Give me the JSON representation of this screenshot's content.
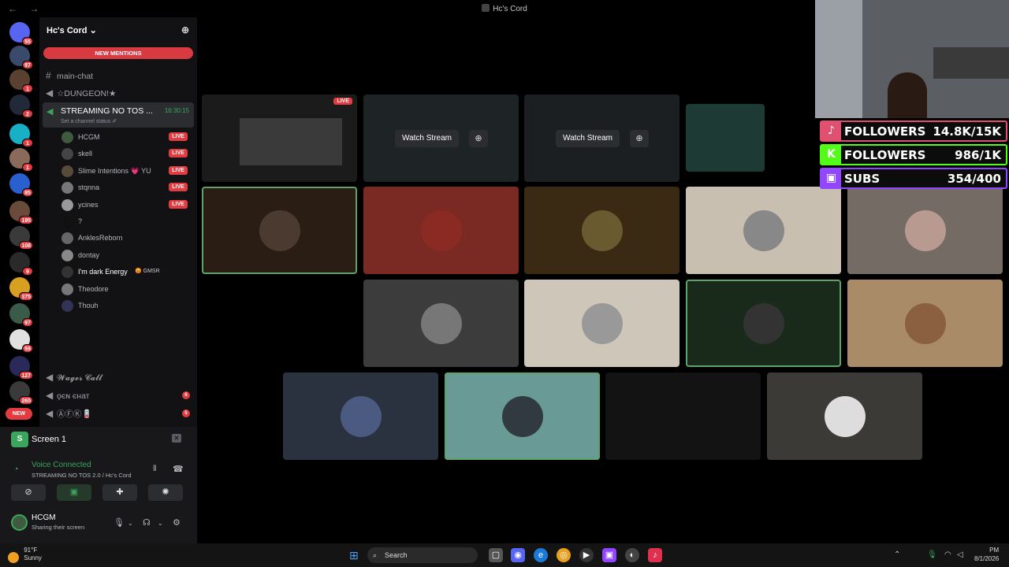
{
  "window": {
    "title": "Hc's Cord",
    "nav_back": "←",
    "nav_fwd": "→"
  },
  "servers": [
    {
      "badge": "55",
      "color": "#5865f2"
    },
    {
      "badge": "97",
      "color": "#3a4a6a"
    },
    {
      "badge": "1",
      "color": "#5a4030"
    },
    {
      "badge": "2",
      "color": "#222a3a"
    },
    {
      "badge": "1",
      "color": "#17b0c6"
    },
    {
      "badge": "1",
      "color": "#8a6a5a"
    },
    {
      "badge": "85",
      "color": "#2a5fd0"
    },
    {
      "badge": "195",
      "color": "#6a4a3a"
    },
    {
      "badge": "108",
      "color": "#3a3a3a"
    },
    {
      "badge": "9",
      "color": "#2a2a2a"
    },
    {
      "badge": "375",
      "color": "#d8a020"
    },
    {
      "badge": "97",
      "color": "#3a5a4a"
    },
    {
      "badge": "59",
      "color": "#e0e0e0"
    },
    {
      "badge": "127",
      "color": "#2a2a5a"
    },
    {
      "badge": "265",
      "color": "#3a3a3a"
    }
  ],
  "new_pill": "NEW",
  "server_name": "Hc's Cord",
  "server_caret": "⌄",
  "new_mentions": "NEW MENTIONS",
  "channels": {
    "main_chat": "main-chat",
    "dungeon": "☆DUNGEON!★",
    "wager": "𝓦𝓪𝓰𝓮𝓻 𝓒𝓪𝓵𝓵",
    "gen": "ǫєɴ єнат",
    "afk": "ⒶⒻⓀ🪫"
  },
  "channel_badges": {
    "gen": "6",
    "afk": "5"
  },
  "voice_channel": {
    "name": "STREAMING NO TOS ...",
    "status": "Set a channel status ✐",
    "timer": "16:30:15"
  },
  "voice_users": [
    {
      "name": "HCGM",
      "live": "LIVE",
      "color": "#3e5b3f"
    },
    {
      "name": "skell",
      "live": "LIVE",
      "color": "#444"
    },
    {
      "name": "Slime Intentions 💗 YU",
      "live": "LIVE",
      "color": "#5a4a3a"
    },
    {
      "name": "stqnna",
      "live": "LIVE",
      "color": "#777"
    },
    {
      "name": "ycines",
      "live": "LIVE",
      "color": "#999"
    },
    {
      "name": "?",
      "live": "",
      "color": "#111"
    },
    {
      "name": "AnklesReborn",
      "live": "",
      "color": "#666"
    },
    {
      "name": "dontay",
      "live": "",
      "color": "#888"
    },
    {
      "name": "I'm dark Energy",
      "tag": "😡 GMSR",
      "live": "",
      "color": "#333"
    },
    {
      "name": "Theodore",
      "live": "",
      "color": "#777"
    },
    {
      "name": "Thouh",
      "live": "",
      "color": "#335"
    }
  ],
  "screen_share": {
    "label": "Screen 1"
  },
  "voice_status": {
    "title": "Voice Connected",
    "sub": "STREAMING NO TOS 2.0 / Hc's Cord"
  },
  "me": {
    "name": "HCGM",
    "status": "Sharing their screen"
  },
  "stage": {
    "live_tag": "LIVE",
    "watch_label": "Watch Stream",
    "tiles": [
      {
        "color": "#2a1d14",
        "av": "#4a3a30",
        "speaking": true
      },
      {
        "color": "#7a2a22",
        "av": "#8a2a22",
        "speaking": false
      },
      {
        "color": "#3a2a14",
        "av": "#6a5a30",
        "speaking": false
      },
      {
        "color": "#c9bfb0",
        "av": "#888",
        "speaking": false
      },
      {
        "color": "#746c64",
        "av": "#b89a90",
        "speaking": false
      },
      {
        "color": "#3c3c3c",
        "av": "#777",
        "speaking": false
      },
      {
        "color": "#cdc6b9",
        "av": "#999",
        "speaking": false
      },
      {
        "color": "#1a2a1a",
        "av": "#333",
        "speaking": true
      },
      {
        "color": "#a98b67",
        "av": "#8a6040",
        "speaking": false
      },
      {
        "color": "#2b323f",
        "av": "#4a5a80",
        "speaking": false
      },
      {
        "color": "#6a9a96",
        "av": "#303a40",
        "speaking": true
      },
      {
        "color": "#131313",
        "av": "",
        "speaking": false
      },
      {
        "color": "#3c3a36",
        "av": "#ddd",
        "speaking": false
      }
    ]
  },
  "overlay": [
    {
      "icon": "♪",
      "label": "FOLLOWERS",
      "value": "14.8K/15K",
      "color": "#e05070"
    },
    {
      "icon": "K",
      "label": "FOLLOWERS",
      "value": "986/1K",
      "color": "#53fc18"
    },
    {
      "icon": "▣",
      "label": "SUBS",
      "value": "354/400",
      "color": "#9146ff"
    }
  ],
  "taskbar": {
    "temp": "91°F",
    "cond": "Sunny",
    "search": "Search",
    "time": "PM",
    "date": "8/1/2026"
  }
}
